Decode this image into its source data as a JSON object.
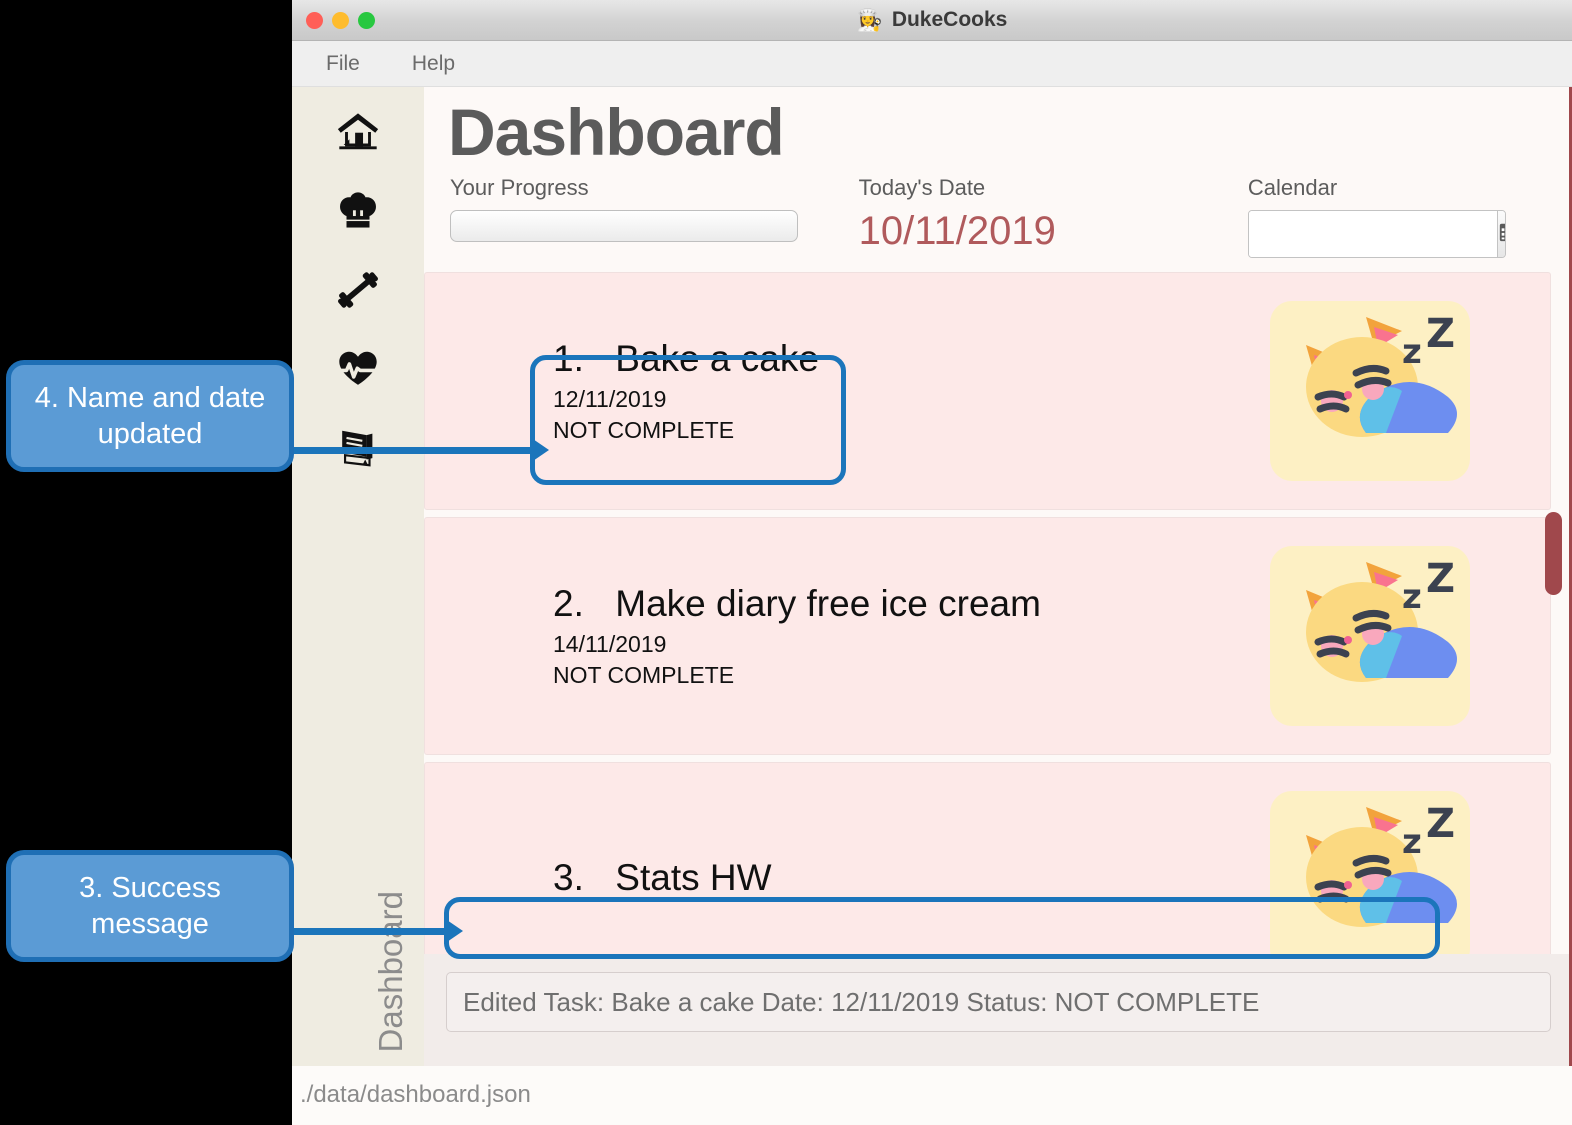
{
  "window": {
    "title": "DukeCooks",
    "title_emoji": "👩‍🍳",
    "traffic_lights": [
      "close-red",
      "minimize-yellow",
      "maximize-green"
    ]
  },
  "menubar": {
    "items": [
      {
        "label": "File"
      },
      {
        "label": "Help"
      }
    ]
  },
  "sidebar": {
    "icons": [
      {
        "name": "home-icon",
        "label": "Home"
      },
      {
        "name": "chef-hat-icon",
        "label": "Recipes"
      },
      {
        "name": "dumbbell-icon",
        "label": "Workout"
      },
      {
        "name": "heart-pulse-icon",
        "label": "Health"
      },
      {
        "name": "book-icon",
        "label": "Diary"
      }
    ],
    "vertical_label": "Dashboard"
  },
  "header": {
    "page_title": "Dashboard",
    "progress_label": "Your Progress",
    "progress_percent": 0,
    "date_label": "Today's Date",
    "date_value": "10/11/2019",
    "calendar_label": "Calendar",
    "calendar_value": "",
    "calendar_placeholder": ""
  },
  "tasks": [
    {
      "number": "1.",
      "name": "Bake a cake",
      "date": "12/11/2019",
      "status": "NOT COMPLETE",
      "thumb": "sleeping-cat-emoji"
    },
    {
      "number": "2.",
      "name": "Make diary free ice cream",
      "date": "14/11/2019",
      "status": "NOT COMPLETE",
      "thumb": "sleeping-cat-emoji"
    },
    {
      "number": "3.",
      "name": "Stats HW",
      "date": "",
      "status": "",
      "thumb": "sleeping-cat-emoji"
    }
  ],
  "result": {
    "message": "Edited Task: Bake a cake Date: 12/11/2019 Status: NOT COMPLETE"
  },
  "footer": {
    "path": "./data/dashboard.json"
  },
  "annotations": [
    {
      "id": "callout-4",
      "text": "4. Name and date updated"
    },
    {
      "id": "callout-3",
      "text": "3. Success message"
    }
  ],
  "colors": {
    "sidebar_bg": "#efece1",
    "main_bg": "#fdf9f7",
    "card_bg": "#fde9e8",
    "accent_red": "#a0484c",
    "date_text": "#b05a5c",
    "annotation_fill": "#5b9bd5",
    "annotation_border": "#1f6fb5",
    "arrow": "#1b75bb",
    "thumb_bg": "#fdf0c4"
  }
}
